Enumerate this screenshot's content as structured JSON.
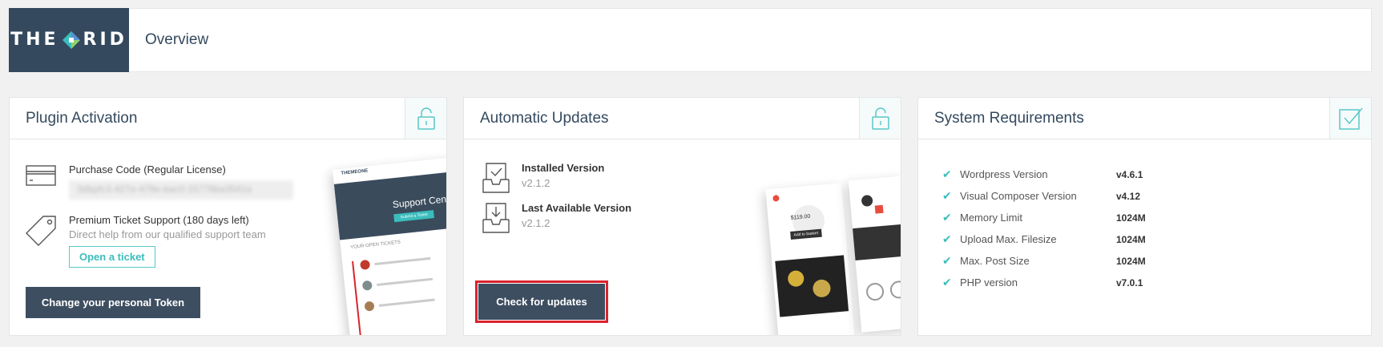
{
  "header": {
    "logo_text_left": "THE",
    "logo_text_right": "RID",
    "page_title": "Overview"
  },
  "activation": {
    "title": "Plugin Activation",
    "purchase_label": "Purchase Code (Regular License)",
    "purchase_code": "3dbpfc3-427e-478e-bac0-15778ba3541a",
    "support_label": "Premium Ticket Support (180 days left)",
    "support_desc": "Direct help from our qualified support team",
    "ticket_button": "Open a ticket",
    "token_button": "Change your personal Token",
    "mock_header": "THEMEONE",
    "mock_banner": "Support Center",
    "mock_banner_button": "Submit a Ticket",
    "mock_list_title": "YOUR OPEN TICKETS"
  },
  "updates": {
    "title": "Automatic Updates",
    "installed_label": "Installed Version",
    "installed_value": "v2.1.2",
    "available_label": "Last Available Version",
    "available_value": "v2.1.2",
    "check_button": "Check for updates",
    "mock_price": "$119.00",
    "mock_cta": "Add to basket"
  },
  "requirements": {
    "title": "System Requirements",
    "items": [
      {
        "name": "Wordpress Version",
        "value": "v4.6.1"
      },
      {
        "name": "Visual Composer Version",
        "value": "v4.12"
      },
      {
        "name": "Memory Limit",
        "value": "1024M"
      },
      {
        "name": "Upload Max. Filesize",
        "value": "1024M"
      },
      {
        "name": "Max. Post Size",
        "value": "1024M"
      },
      {
        "name": "PHP version",
        "value": "v7.0.1"
      }
    ]
  },
  "colors": {
    "dark": "#34495e",
    "accent": "#3bbdbd",
    "highlight": "#d9232d"
  }
}
